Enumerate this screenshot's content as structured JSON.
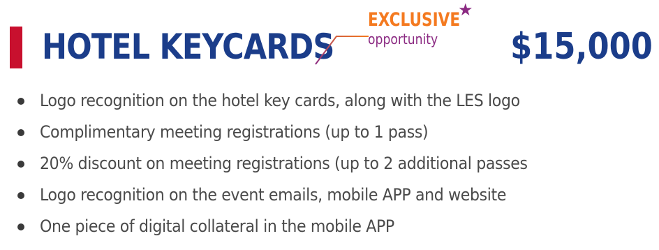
{
  "colors": {
    "title": "#1b3d8a",
    "accent_bar": "#c8102e",
    "exclusive": "#f47a20",
    "opportunity": "#8b2a82",
    "body_text": "#4a4a4a"
  },
  "header": {
    "title": "HOTEL KEYCARDS",
    "price": "$15,000"
  },
  "badge": {
    "exclusive": "EXCLUSIVE",
    "opportunity": "opportunity",
    "star_icon": "star-icon"
  },
  "benefits": [
    "Logo recognition on the hotel key cards, along with the LES logo",
    "Complimentary meeting registrations (up to 1 pass)",
    "20% discount on meeting registrations (up to 2 additional passes",
    "Logo recognition on the event emails, mobile APP and website",
    "One piece of digital collateral in the mobile APP"
  ]
}
